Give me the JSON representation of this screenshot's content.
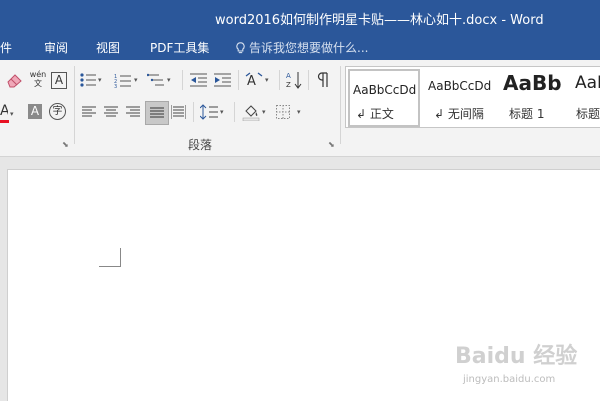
{
  "window": {
    "title": "word2016如何制作明星卡贴——林心如十.docx - Word"
  },
  "tabs": [
    {
      "label": "文件"
    },
    {
      "label": "审阅"
    },
    {
      "label": "视图"
    },
    {
      "label": "PDF工具集"
    }
  ],
  "tellme": {
    "placeholder": "告诉我您想要做什么..."
  },
  "ribbon": {
    "paragraph_group_label": "段落",
    "buttons": [
      "clear-formatting",
      "phonetic-guide",
      "character-border",
      "bullets",
      "numbering",
      "multilevel-list",
      "decrease-indent",
      "increase-indent",
      "chinese-layout",
      "sort",
      "show-marks",
      "font-color",
      "character-shading",
      "enclosed-characters",
      "align-left",
      "center",
      "align-right",
      "justify",
      "distributed",
      "line-spacing",
      "shading",
      "borders"
    ],
    "phonetic_glyph": "wén\n文",
    "char_border_glyph": "A",
    "shading_glyph": "A",
    "enclosed_glyph": "字",
    "font_color_glyph": "A",
    "font_color": "#e81123"
  },
  "styles": [
    {
      "preview": "AaBbCcDd",
      "name": "↲ 正文",
      "selected": true
    },
    {
      "preview": "AaBbCcDd",
      "name": "↲ 无间隔",
      "selected": false
    },
    {
      "preview": "AaBb",
      "name": "标题 1",
      "selected": false
    },
    {
      "preview": "AaB",
      "name": "标题",
      "selected": false
    }
  ],
  "watermark": {
    "main": "Baidu 经验",
    "sub": "jingyan.baidu.com"
  },
  "colors": {
    "titlebar": "#2b579a",
    "ribbon": "#f3f3f3",
    "doc_bg": "#e6e6e6",
    "page": "#ffffff"
  }
}
